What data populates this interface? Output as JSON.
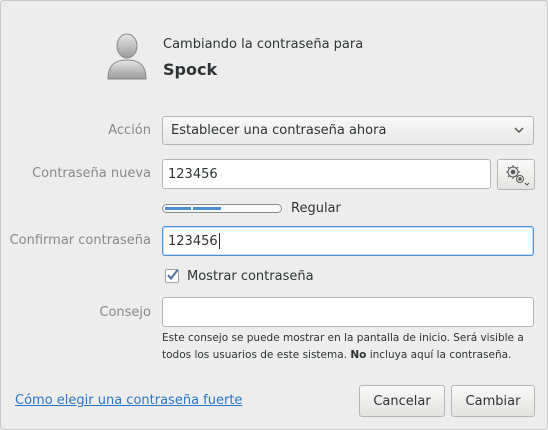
{
  "header": {
    "title_line": "Cambiando la contraseña para",
    "user_name": "Spock",
    "avatar_icon": "user-avatar-icon"
  },
  "action": {
    "label": "Acción",
    "selected": "Establecer una contraseña ahora"
  },
  "new_password": {
    "label": "Contraseña nueva",
    "value": "123456",
    "generate_icon": "gears-icon"
  },
  "strength": {
    "label": "Regular",
    "level": 0.5
  },
  "confirm_password": {
    "label": "Confirmar contraseña",
    "value": "123456"
  },
  "show_password": {
    "label": "Mostrar contraseña",
    "checked": true
  },
  "hint": {
    "label": "Consejo",
    "value": "",
    "help_part1": "Este consejo se puede mostrar en la pantalla de inicio. Será visible a todos los usuarios de este sistema. ",
    "help_bold": "No",
    "help_part2": " incluya aquí la contraseña."
  },
  "footer": {
    "link": "Cómo elegir una contraseña fuerte",
    "cancel": "Cancelar",
    "apply": "Cambiar"
  },
  "colors": {
    "accent": "#4a90d9",
    "link": "#2a76c6",
    "muted_label": "#888a85"
  }
}
